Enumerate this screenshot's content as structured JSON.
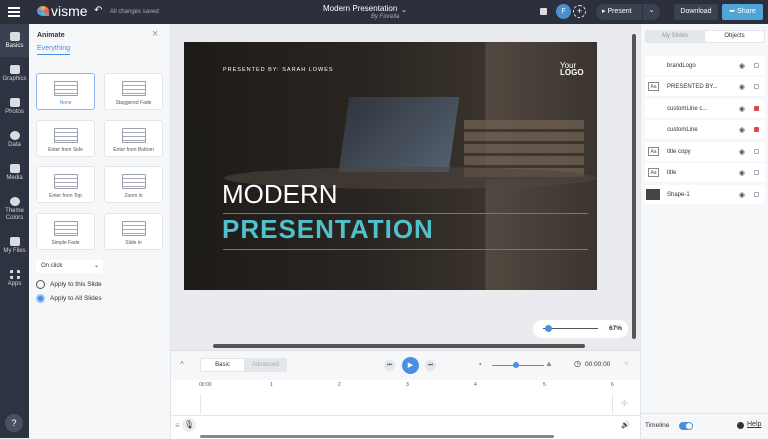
{
  "topbar": {
    "brand": "visme",
    "save_status": "All changes saved",
    "doc_title": "Modern Presentation",
    "doc_author": "By Fiorella",
    "avatar_initial": "F",
    "present_label": "Present",
    "download_label": "Download",
    "share_label": "Share"
  },
  "leftnav": [
    {
      "label": "Basics"
    },
    {
      "label": "Graphics"
    },
    {
      "label": "Photos"
    },
    {
      "label": "Data"
    },
    {
      "label": "Media"
    },
    {
      "label": "Theme Colors"
    },
    {
      "label": "My Files"
    },
    {
      "label": "Apps"
    }
  ],
  "help_glyph": "?",
  "animate": {
    "title": "Animate",
    "tab": "Everything",
    "options": [
      "None",
      "Staggered Fade",
      "Enter from Side",
      "Enter from Bottom",
      "Enter from Top",
      "Zoom in",
      "Simple Fade",
      "Slide in"
    ],
    "selected": "None",
    "trigger": "On click",
    "apply_this": "Apply to this Slide",
    "apply_all": "Apply to All Slides",
    "apply_selected": "all"
  },
  "slide": {
    "presenter": "PRESENTED BY: SARAH LOWES",
    "logo_top": "Your",
    "logo_bottom": "LOGO",
    "title1": "MODERN",
    "title2": "PRESENTATION",
    "accent": "#4fc1cc"
  },
  "zoom": {
    "value": "67%",
    "fraction": 0.67
  },
  "right": {
    "tab_slides": "My Slides",
    "tab_objects": "Objects",
    "objects": [
      {
        "name": "brandLogo",
        "icon": "none",
        "locked": false
      },
      {
        "name": "PRESENTED BY...",
        "icon": "text",
        "locked": false
      },
      {
        "name": "customLine c...",
        "icon": "none",
        "locked": true
      },
      {
        "name": "customLine",
        "icon": "none",
        "locked": true
      },
      {
        "name": "title copy",
        "icon": "text",
        "locked": false
      },
      {
        "name": "title",
        "icon": "text",
        "locked": false
      },
      {
        "name": "Shape-1",
        "icon": "shape",
        "locked": false
      }
    ],
    "icon_text": "Aa",
    "timeline_label": "Timeline",
    "help_label": "Help"
  },
  "timeline": {
    "tab_basic": "Basic",
    "tab_advanced": "Advanced",
    "time": "00:00:00",
    "ticks": [
      "00:00",
      "1",
      "2",
      "3",
      "4",
      "5",
      "6"
    ],
    "speed_fraction": 0.6
  }
}
